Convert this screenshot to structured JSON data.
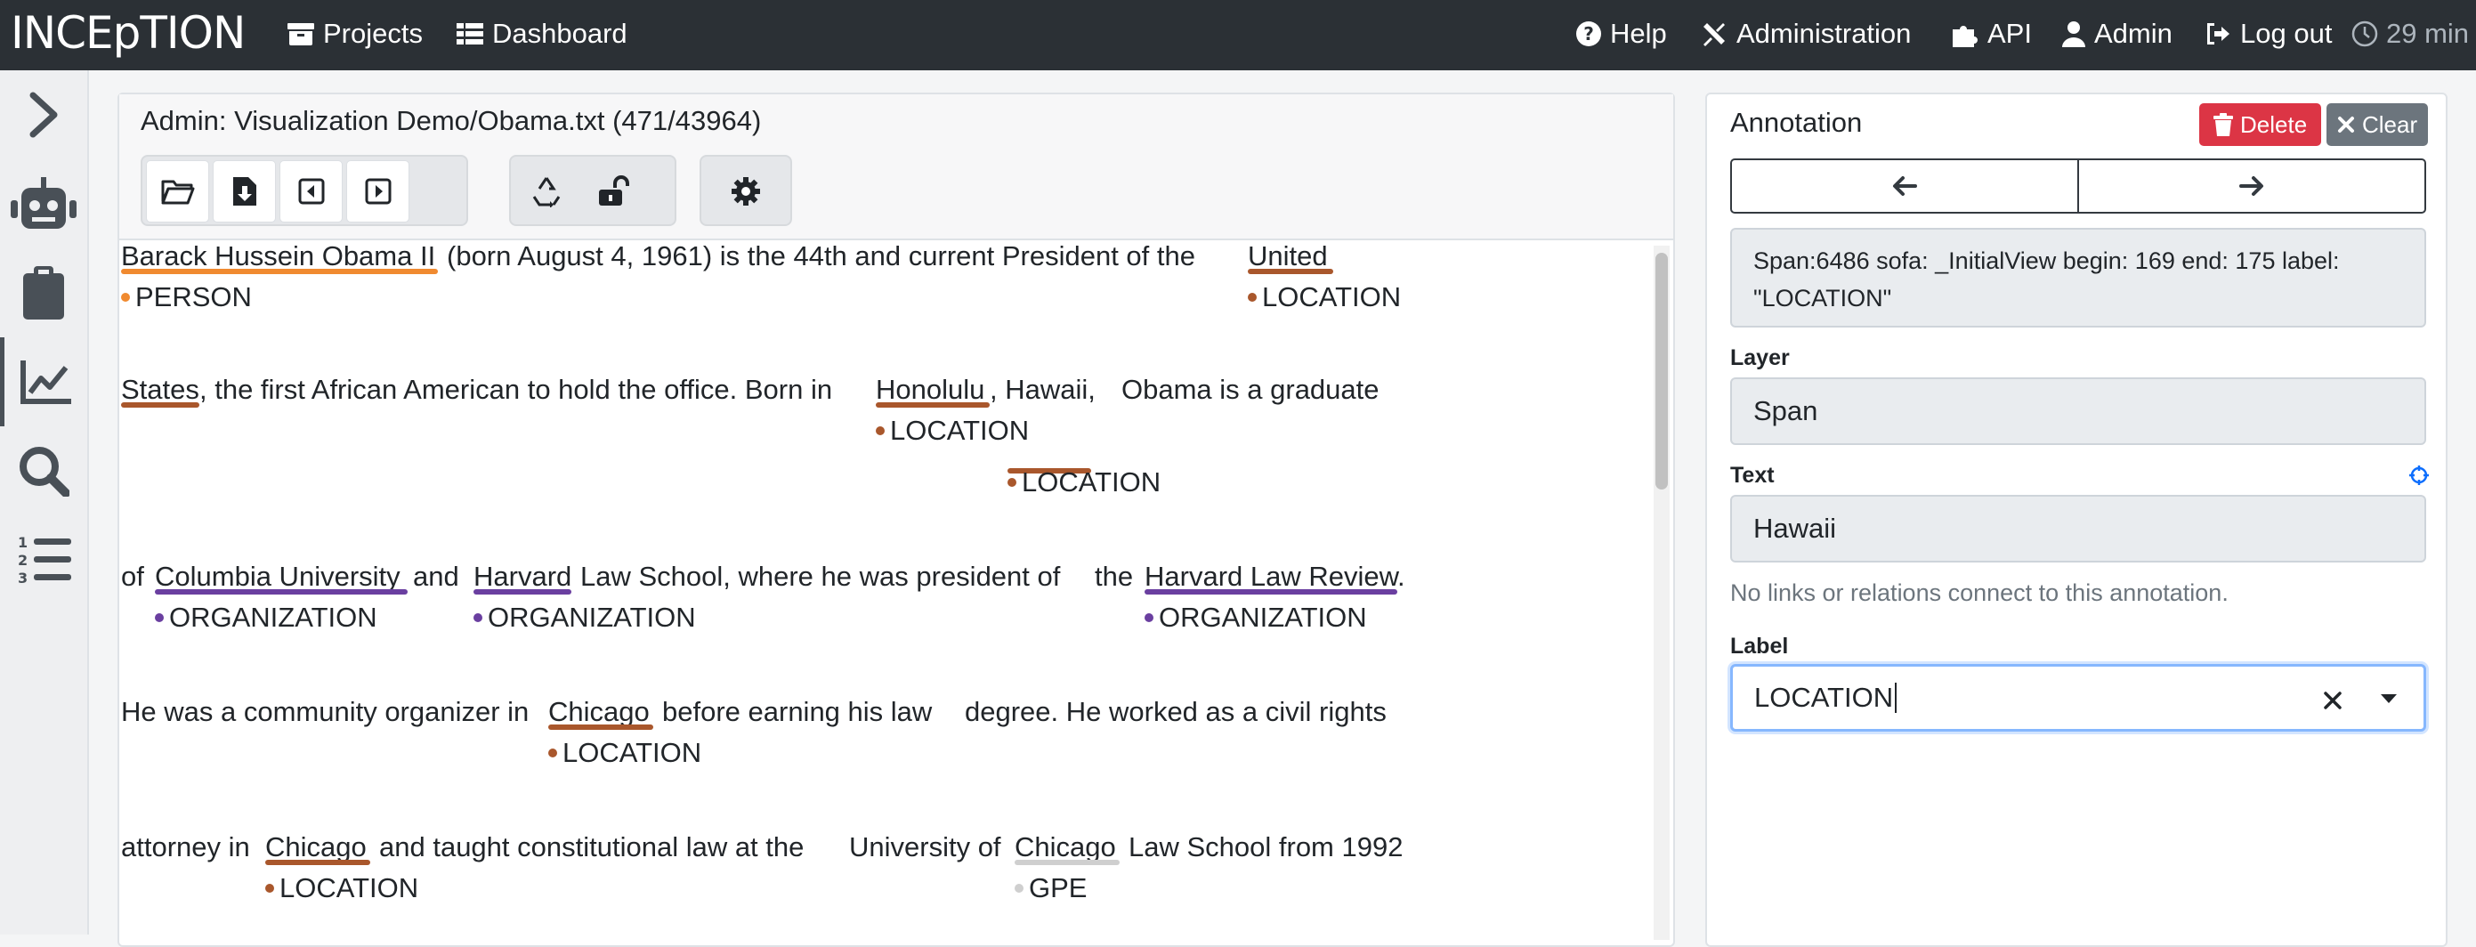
{
  "app": {
    "brand": "INCEpTION"
  },
  "nav": {
    "projects": "Projects",
    "dashboard": "Dashboard",
    "help": "Help",
    "administration": "Administration",
    "api": "API",
    "admin": "Admin",
    "logout": "Log out",
    "timer": "29 min"
  },
  "sidebar": {
    "items": [
      {
        "icon": "chevron-right-icon"
      },
      {
        "icon": "robot-icon"
      },
      {
        "icon": "clipboard-icon"
      },
      {
        "icon": "chart-line-icon",
        "active": true
      },
      {
        "icon": "search-icon"
      },
      {
        "icon": "list-ol-icon"
      }
    ]
  },
  "document": {
    "title": "Admin: Visualization Demo/Obama.txt (471/43964)",
    "lines": [
      {
        "tokens": [
          "Barack Hussein Obama II",
          "(born August 4, 1961) is the 44th and current President of the",
          "United"
        ],
        "labels": [
          "PERSON",
          "LOCATION"
        ]
      },
      {
        "tokens": [
          "States",
          ", the first African American to hold the office. Born in",
          "Honolulu",
          ", Hawaii,",
          "Obama is a graduate"
        ],
        "labels": [
          "LOCATION",
          "LOCATION"
        ]
      },
      {
        "tokens": [
          "of",
          "Columbia University",
          "and",
          "Harvard",
          "Law School, where he was president of",
          "the",
          "Harvard Law Review",
          "."
        ],
        "labels": [
          "ORGANIZATION",
          "ORGANIZATION",
          "ORGANIZATION"
        ]
      },
      {
        "tokens": [
          "He was a community organizer in",
          "Chicago",
          "before earning his law",
          "degree. He worked as a civil rights"
        ],
        "labels": [
          "LOCATION"
        ]
      },
      {
        "tokens": [
          "attorney in",
          "Chicago",
          "and taught constitutional law at the",
          "University of",
          "Chicago",
          "Law School from 1992"
        ],
        "labels": [
          "LOCATION",
          "GPE"
        ]
      }
    ],
    "colors": {
      "person": "#f08a30",
      "location": "#a9572c",
      "organization": "#6a3fa0",
      "gpe": "#cfcfcf"
    }
  },
  "annotation": {
    "title": "Annotation",
    "delete_label": "Delete",
    "clear_label": "Clear",
    "info": "Span:6486 sofa: _InitialView begin: 169 end: 175 label: \"LOCATION\"",
    "layer_label": "Layer",
    "layer_value": "Span",
    "text_label": "Text",
    "text_value": "Hawaii",
    "relations_note": "No links or relations connect to this annotation.",
    "label_label": "Label",
    "label_value": "LOCATION"
  }
}
